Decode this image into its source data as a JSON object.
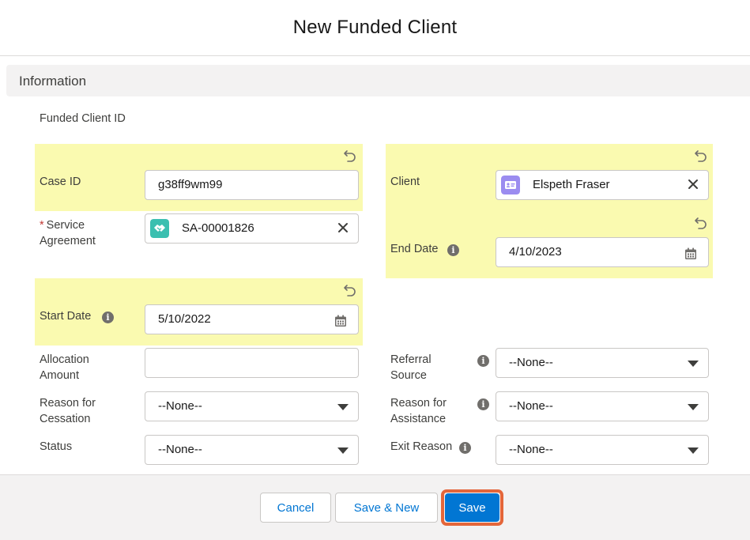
{
  "modal": {
    "title": "New Funded Client"
  },
  "section": {
    "title": "Information"
  },
  "fields": {
    "funded_client_id": {
      "label": "Funded Client ID"
    },
    "case_id": {
      "label": "Case ID",
      "value": "g38ff9wm99"
    },
    "client": {
      "label": "Client",
      "value": "Elspeth Fraser",
      "icon": "contact-card-icon"
    },
    "service_agreement": {
      "required": "*",
      "label": "Service Agreement",
      "value": "SA-00001826",
      "icon": "handshake-icon"
    },
    "end_date": {
      "label": "End Date",
      "value": "4/10/2023"
    },
    "start_date": {
      "label": "Start Date",
      "value": "5/10/2022"
    },
    "allocation_amount": {
      "label": "Allocation Amount",
      "value": ""
    },
    "referral_source": {
      "label": "Referral Source",
      "value": "--None--"
    },
    "reason_for_cessation": {
      "label": "Reason for Cessation",
      "value": "--None--"
    },
    "reason_for_assistance": {
      "label": "Reason for Assistance",
      "value": "--None--"
    },
    "status": {
      "label": "Status",
      "value": "--None--"
    },
    "exit_reason": {
      "label": "Exit Reason",
      "value": "--None--"
    }
  },
  "footer": {
    "cancel_label": "Cancel",
    "save_new_label": "Save & New",
    "save_label": "Save"
  },
  "colors": {
    "highlight": "#fafab0",
    "brand": "#0176d3",
    "focus_ring": "#e4663a",
    "required": "#c23934",
    "contact_icon": "#9b8cf0",
    "agreement_icon": "#3bbfb0"
  }
}
